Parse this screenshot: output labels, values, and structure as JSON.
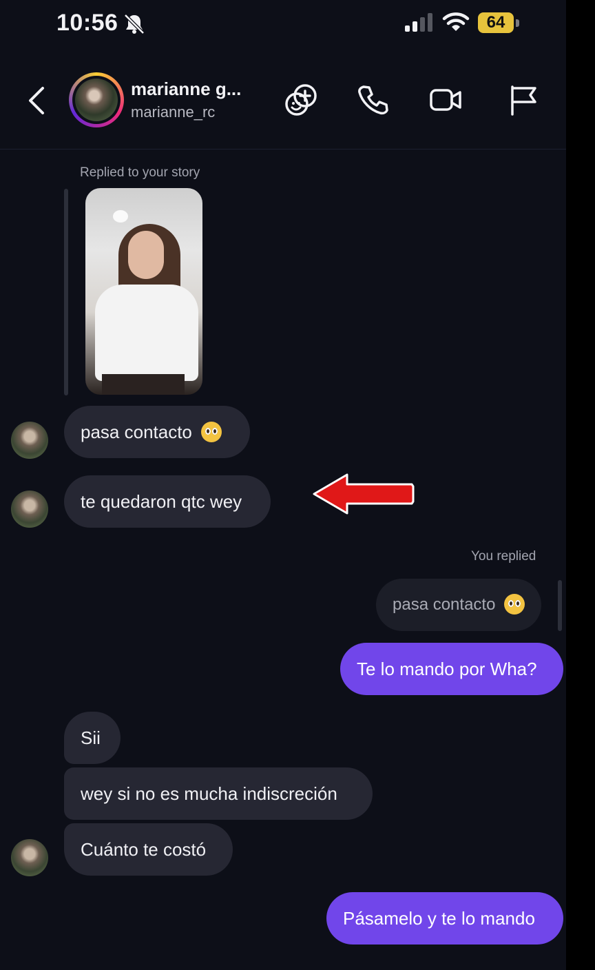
{
  "status_bar": {
    "time": "10:56",
    "battery": "64",
    "icons": [
      "bell-slash-icon",
      "cellular-signal-icon",
      "wifi-icon",
      "battery-icon"
    ]
  },
  "header": {
    "display_name": "marianne g...",
    "username": "marianne_rc",
    "actions": [
      "add-effect-icon",
      "phone-icon",
      "video-camera-icon",
      "flag-icon"
    ]
  },
  "thread": {
    "story_reply_label": "Replied to your story",
    "you_replied_label": "You replied",
    "messages": [
      {
        "from": "them",
        "text": "pasa contacto"
      },
      {
        "from": "them",
        "text": "te quedaron qtc wey"
      },
      {
        "from": "me",
        "quoted": "pasa contacto",
        "text": "Te lo mando por Wha?"
      },
      {
        "from": "them",
        "text": "Sii"
      },
      {
        "from": "them",
        "text": "wey si no es mucha indiscreción"
      },
      {
        "from": "them",
        "text": "Cuánto te costó"
      },
      {
        "from": "me",
        "text": "Pásamelo y te lo mando"
      }
    ]
  },
  "colors": {
    "background": "#0d0f18",
    "incoming_bubble": "#262733",
    "outgoing_bubble": "#7146ea",
    "annotation_arrow": "#e01818"
  }
}
